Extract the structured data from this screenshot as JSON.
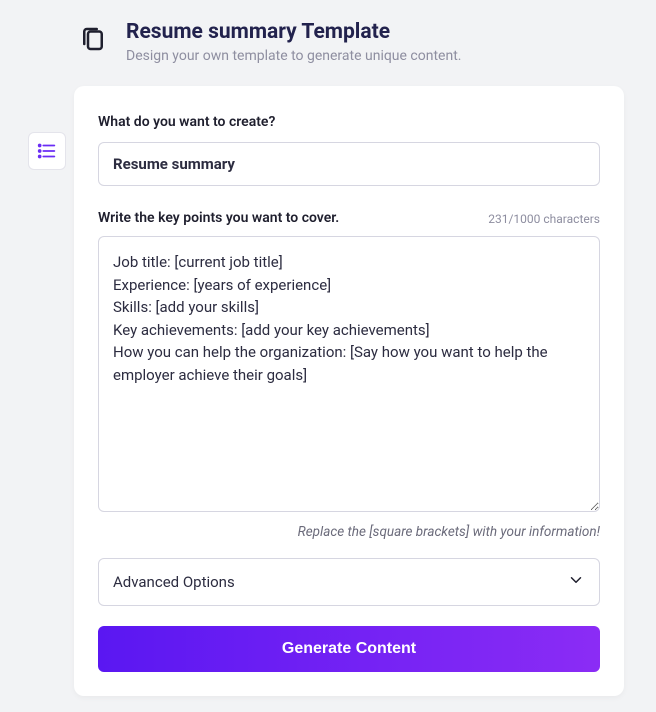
{
  "header": {
    "title": "Resume summary Template",
    "subtitle": "Design your own template to generate unique content."
  },
  "form": {
    "create_label": "What do you want to create?",
    "create_value": "Resume summary",
    "keypoints_label": "Write the key points you want to cover.",
    "char_count": "231/1000 characters",
    "keypoints_value": "Job title: [current job title]\nExperience: [years of experience]\nSkills: [add your skills]\nKey achievements: [add your key achievements]\nHow you can help the organization: [Say how you want to help the employer achieve their goals]",
    "hint": "Replace the [square brackets] with your information!",
    "advanced_label": "Advanced Options",
    "generate_label": "Generate Content"
  }
}
